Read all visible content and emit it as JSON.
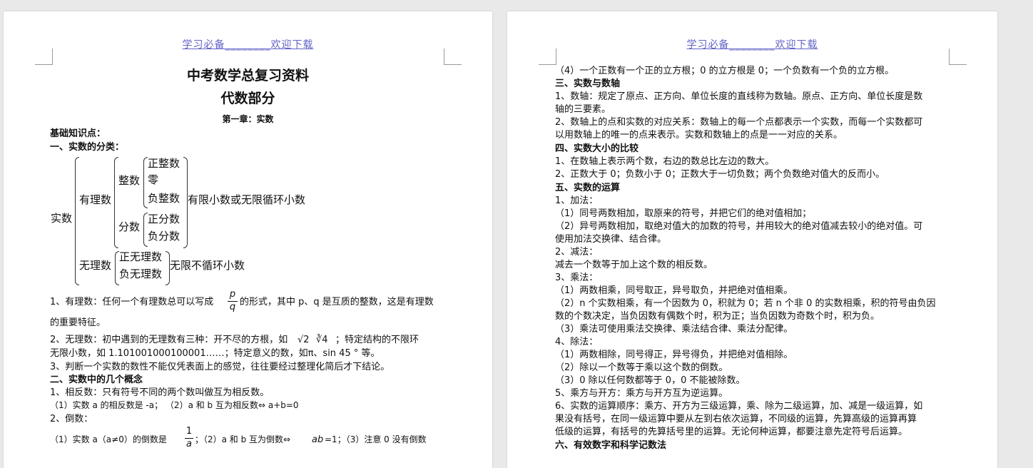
{
  "header": "学习必备________欢迎下载",
  "page1": {
    "title": "中考数学总复习资料",
    "subtitle": "代数部分",
    "chapter": "第一章：实数",
    "basic": "基础知识点：",
    "sec1": "一、实数的分类：",
    "tree": {
      "root": "实数",
      "rational": "有理数",
      "integer": "整数",
      "pos_int": "正整数",
      "zero": "零",
      "neg_int": "负整数",
      "fraction": "分数",
      "pos_frac": "正分数",
      "neg_frac": "负分数",
      "rational_note": "有限小数或无限循环小数",
      "irrational": "无理数",
      "pos_irr": "正无理数",
      "neg_irr": "负无理数",
      "irrational_note": "无限不循环小数"
    },
    "p1a": "1、有理数：任何一个有理数总可以写成",
    "frac_p": "p",
    "frac_q": "q",
    "p1b": "的形式，其中 p、q 是互质的整数，这是有理数",
    "p1c": "的重要特征。",
    "p2a": "2、无理数：初中遇到的无理数有三种：开不尽的方根，如",
    "sqrt2": "√2",
    "cbrt4": "∛4",
    "p2b": "；特定结构的不限环",
    "p2c": "无限小数，如 1.101001000100001……；特定意义的数，如π、sin 45 ° 等。",
    "p3": "3、判断一个实数的数性不能仅凭表面上的感觉，往往要经过整理化简后才下结论。",
    "sec2": "二、实数中的几个概念",
    "c1": "1、相反数：只有符号不同的两个数叫做互为相反数。",
    "c1a": "（1）实数 a 的相反数是 -a；  （2）a 和 b 互为相反数⇔ a+b=0",
    "c2": "2、倒数：",
    "c2a": "（1）实数 a（a≠0）的倒数是",
    "frac_1": "1",
    "frac_a": "a",
    "c2b": "；（2）a 和 b 互为倒数⇔",
    "c2ab": "ab",
    "c2c": "=1；（3）注意 0 没有倒数"
  },
  "page2": {
    "l1": "（4）一个正数有一个正的立方根；0 的立方根是 0；一个负数有一个负的立方根。",
    "s3": "三、实数与数轴",
    "l2": "1、数轴：规定了原点、正方向、单位长度的直线称为数轴。原点、正方向、单位长度是数",
    "l3": "轴的三要素。",
    "l4": "2、数轴上的点和实数的对应关系：数轴上的每一个点都表示一个实数，而每一个实数都可",
    "l5": "以用数轴上的唯一的点来表示。实数和数轴上的点是一一对应的关系。",
    "s4": "四、实数大小的比较",
    "l6": "1、在数轴上表示两个数，右边的数总比左边的数大。",
    "l7": "2、正数大于 0；负数小于 0；正数大于一切负数；两个负数绝对值大的反而小。",
    "s5": "五、实数的运算",
    "l8": "1、加法：",
    "l9": "（1）同号两数相加，取原来的符号，并把它们的绝对值相加；",
    "l10": "（2）异号两数相加，取绝对值大的加数的符号，并用较大的绝对值减去较小的绝对值。可",
    "l11": "使用加法交换律、结合律。",
    "l12": "2、减法：",
    "l13": "减去一个数等于加上这个数的相反数。",
    "l14": "3、乘法：",
    "l15": "（1）两数相乘，同号取正，异号取负，并把绝对值相乘。",
    "l16": "（2）n 个实数相乘，有一个因数为 0，积就为 0；若 n 个非 0 的实数相乘，积的符号由负因",
    "l17": "数的个数决定，当负因数有偶数个时，积为正；当负因数为奇数个时，积为负。",
    "l18": "（3）乘法可使用乘法交换律、乘法结合律、乘法分配律。",
    "l19": "4、除法：",
    "l20": "（1）两数相除，同号得正，异号得负，并把绝对值相除。",
    "l21": "（2）除以一个数等于乘以这个数的倒数。",
    "l22": "（3）0 除以任何数都等于 0，0 不能被除数。",
    "l23": "5、乘方与开方：乘方与开方互为逆运算。",
    "l24": "6、实数的运算顺序：乘方、开方为三级运算，乘、除为二级运算，加、减是一级运算，如",
    "l25": "果没有括号，在同一级运算中要从左到右依次运算，不同级的运算，先算高级的运算再算",
    "l26": "低级的运算，有括号的先算括号里的运算。无论何种运算，都要注意先定符号后运算。",
    "s6": "六、有效数字和科学记数法"
  }
}
